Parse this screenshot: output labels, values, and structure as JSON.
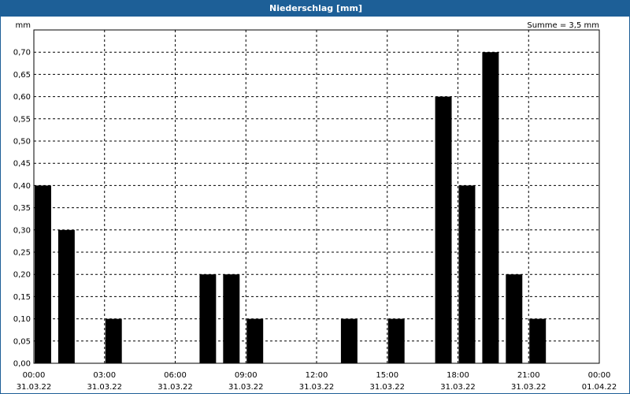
{
  "window": {
    "title": "Niederschlag [mm]"
  },
  "chart_data": {
    "type": "bar",
    "ylabel": "mm",
    "summary": "Summe = 3,5 mm",
    "ylim": [
      0,
      0.75
    ],
    "yticks": [
      "0,00",
      "0,05",
      "0,10",
      "0,15",
      "0,20",
      "0,25",
      "0,30",
      "0,35",
      "0,40",
      "0,45",
      "0,50",
      "0,55",
      "0,60",
      "0,65",
      "0,70"
    ],
    "xticks": [
      {
        "time": "00:00",
        "date": "31.03.22"
      },
      {
        "time": "03:00",
        "date": "31.03.22"
      },
      {
        "time": "06:00",
        "date": "31.03.22"
      },
      {
        "time": "09:00",
        "date": "31.03.22"
      },
      {
        "time": "12:00",
        "date": "31.03.22"
      },
      {
        "time": "15:00",
        "date": "31.03.22"
      },
      {
        "time": "18:00",
        "date": "31.03.22"
      },
      {
        "time": "21:00",
        "date": "31.03.22"
      },
      {
        "time": "00:00",
        "date": "01.04.22"
      }
    ],
    "series": [
      {
        "color": "#000000",
        "values": [
          0.4,
          0.3,
          0.0,
          0.1,
          0.0,
          0.0,
          0.0,
          0.2,
          0.2,
          0.1,
          0.0,
          0.0,
          0.0,
          0.1,
          0.0,
          0.1,
          0.0,
          0.6,
          0.4,
          0.7,
          0.2,
          0.1,
          0.0,
          0.0,
          0.0
        ]
      }
    ],
    "x_start": "31.03.22 00:00",
    "x_end": "01.04.22 00:00",
    "bar_interval_hours": 1,
    "grid": true
  }
}
